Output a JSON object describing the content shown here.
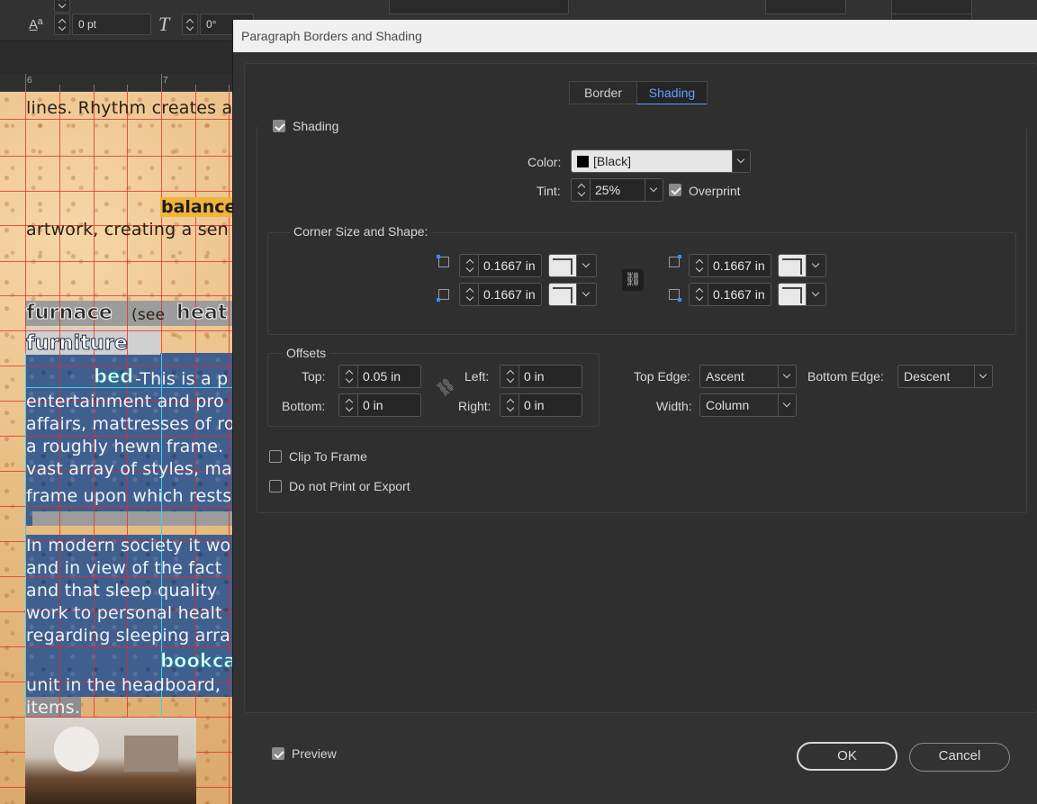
{
  "topbar": {
    "tracking_value": "0 pt",
    "skew_value": "0°"
  },
  "ruler": {
    "marks": [
      "6",
      "7"
    ]
  },
  "document": {
    "lines": [
      "lines. Rhythm creates a",
      "balance",
      "artwork, creating a sen",
      "furnace",
      "(see",
      "heat",
      "furniture",
      "bed",
      "-This is a p",
      "entertainment and pro",
      "affairs, mattresses of ro",
      "a roughly hewn frame.",
      "vast array of styles, ma",
      "frame upon which rests",
      "In modern society it wo",
      "and in view of the fact",
      "and that sleep quality",
      "work to personal healt",
      "regarding sleeping arra",
      "bookca",
      "unit in the headboard,",
      "items."
    ]
  },
  "dialog": {
    "title": "Paragraph Borders and Shading",
    "tabs": [
      {
        "label": "Border",
        "selected": false
      },
      {
        "label": "Shading",
        "selected": true
      }
    ],
    "shading": {
      "label": "Shading",
      "checked": true
    },
    "color": {
      "label": "Color:",
      "value": "[Black]",
      "swatch": "#000000"
    },
    "tint": {
      "label": "Tint:",
      "value": "25%"
    },
    "overprint": {
      "label": "Overprint",
      "checked": true
    },
    "corner": {
      "heading": "Corner Size and Shape:",
      "top_left": "0.1667 in",
      "bottom_left": "0.1667 in",
      "top_right": "0.1667 in",
      "bottom_right": "0.1667 in"
    },
    "offsets": {
      "heading": "Offsets",
      "top_label": "Top:",
      "top_value": "0.05 in",
      "bottom_label": "Bottom:",
      "bottom_value": "0 in",
      "left_label": "Left:",
      "left_value": "0 in",
      "right_label": "Right:",
      "right_value": "0 in"
    },
    "top_edge": {
      "label": "Top Edge:",
      "value": "Ascent"
    },
    "bottom_edge": {
      "label": "Bottom Edge:",
      "value": "Descent"
    },
    "width": {
      "label": "Width:",
      "value": "Column"
    },
    "clip_to_frame": {
      "label": "Clip To Frame",
      "checked": false
    },
    "do_not_print": {
      "label": "Do not Print or Export",
      "checked": false
    },
    "preview": {
      "label": "Preview",
      "checked": true
    },
    "ok_label": "OK",
    "cancel_label": "Cancel"
  },
  "colors": {
    "accent": "#5ea2ff",
    "dialog_bg": "#323232",
    "titlebar_bg": "#f0f0f0"
  }
}
